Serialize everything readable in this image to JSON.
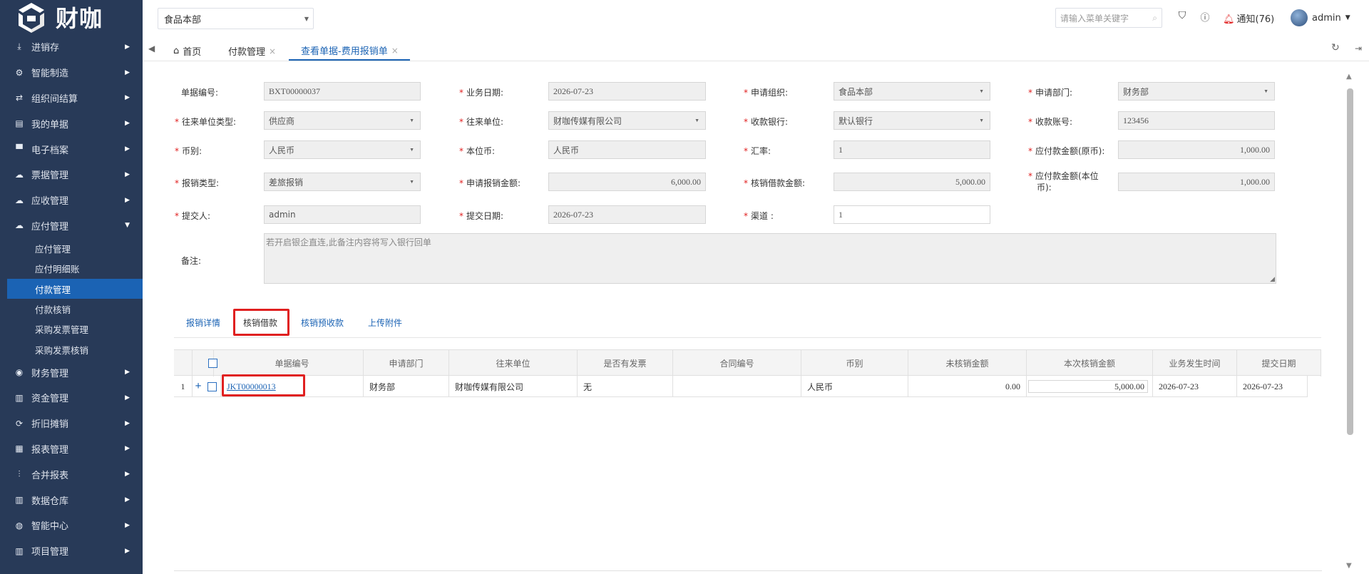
{
  "app": {
    "logo_text": "财咖"
  },
  "sidebar": {
    "items": [
      {
        "label": "进销存",
        "icon": "download-icon"
      },
      {
        "label": "智能制造",
        "icon": "gears-icon"
      },
      {
        "label": "组织间结算",
        "icon": "exchange-icon"
      },
      {
        "label": "我的单据",
        "icon": "document-icon"
      },
      {
        "label": "电子档案",
        "icon": "archive-icon"
      },
      {
        "label": "票据管理",
        "icon": "cloud-upload-icon"
      },
      {
        "label": "应收管理",
        "icon": "cloud-upload-icon"
      },
      {
        "label": "应付管理",
        "icon": "cloud-download-icon"
      }
    ],
    "sub_items": [
      "应付管理",
      "应付明细账",
      "付款管理",
      "付款核销",
      "采购发票管理",
      "采购发票核销"
    ],
    "active_sub": "付款管理",
    "items_after": [
      {
        "label": "财务管理",
        "icon": "circle-icon"
      },
      {
        "label": "资金管理",
        "icon": "bar-chart-icon"
      },
      {
        "label": "折旧摊销",
        "icon": "loop-icon"
      },
      {
        "label": "报表管理",
        "icon": "report-icon"
      },
      {
        "label": "合并报表",
        "icon": "merge-icon"
      },
      {
        "label": "数据仓库",
        "icon": "bar-chart-icon"
      },
      {
        "label": "智能中心",
        "icon": "globe-icon"
      },
      {
        "label": "项目管理",
        "icon": "bar-chart-icon"
      }
    ]
  },
  "header": {
    "org": "食品本部",
    "search_placeholder": "请输入菜单关键字",
    "notice": "通知(76)",
    "user": "admin"
  },
  "tabs": [
    {
      "label": "首页",
      "closable": false
    },
    {
      "label": "付款管理",
      "closable": true
    },
    {
      "label": "查看单据-费用报销单",
      "closable": true,
      "active": true
    }
  ],
  "form": {
    "doc_no": {
      "label": "单据编号:",
      "value": "BXT00000037"
    },
    "biz_date": {
      "label": "业务日期:",
      "value": "2026-07-23"
    },
    "apply_org": {
      "label": "申请组织:",
      "value": "食品本部"
    },
    "apply_dept": {
      "label": "申请部门:",
      "value": "财务部"
    },
    "partner_type": {
      "label": "往来单位类型:",
      "value": "供应商"
    },
    "partner": {
      "label": "往来单位:",
      "value": "财咖传媒有限公司"
    },
    "bank": {
      "label": "收款银行:",
      "value": "默认银行"
    },
    "account": {
      "label": "收款账号:",
      "value": "123456"
    },
    "currency": {
      "label": "币别:",
      "value": "人民币"
    },
    "base_currency": {
      "label": "本位币:",
      "value": "人民币"
    },
    "rate": {
      "label": "汇率:",
      "value": "1"
    },
    "payable_orig": {
      "label": "应付款金额(原币):",
      "value": "1,000.00"
    },
    "expense_type": {
      "label": "报销类型:",
      "value": "差旅报销"
    },
    "apply_amount": {
      "label": "申请报销金额:",
      "value": "6,000.00"
    },
    "loan_amount": {
      "label": "核销借款金额:",
      "value": "5,000.00"
    },
    "payable_base_l1": "应付款金额(本位",
    "payable_base_l2": "币):",
    "payable_base_value": "1,000.00",
    "submitter": {
      "label": "提交人:",
      "value": "admin"
    },
    "submit_date": {
      "label": "提交日期:",
      "value": "2026-07-23"
    },
    "channel": {
      "label": "渠道 :",
      "value": "1"
    },
    "remark": {
      "label": "备注:",
      "placeholder": "若开启银企直连,此备注内容将写入银行回单"
    }
  },
  "subtabs": [
    "报销详情",
    "核销借款",
    "核销预收款",
    "上传附件"
  ],
  "active_subtab": "核销借款",
  "grid": {
    "columns": [
      "单据编号",
      "申请部门",
      "往来单位",
      "是否有发票",
      "合同编号",
      "币别",
      "未核销金额",
      "本次核销金额",
      "业务发生时间",
      "提交日期"
    ],
    "rows": [
      {
        "index": "1",
        "doc_no": "JKT00000013",
        "dept": "财务部",
        "partner": "财咖传媒有限公司",
        "invoice": "无",
        "contract": "",
        "currency": "人民币",
        "unverified": "0.00",
        "verify": "5,000.00",
        "biz_time": "2026-07-23",
        "submit_date": "2026-07-23"
      }
    ]
  },
  "colors": {
    "sidebar_bg": "#283a58",
    "accent": "#1b63b4",
    "highlight": "#e02020"
  }
}
